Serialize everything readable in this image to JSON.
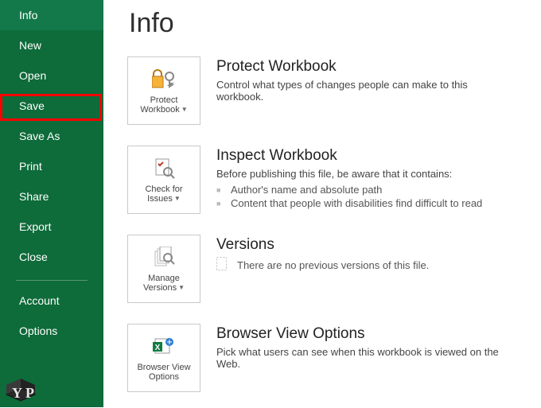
{
  "sidebar": {
    "items": [
      {
        "label": "Info",
        "active": true
      },
      {
        "label": "New"
      },
      {
        "label": "Open"
      },
      {
        "label": "Save",
        "highlighted": true
      },
      {
        "label": "Save As"
      },
      {
        "label": "Print"
      },
      {
        "label": "Share"
      },
      {
        "label": "Export"
      },
      {
        "label": "Close"
      }
    ],
    "footer": [
      {
        "label": "Account"
      },
      {
        "label": "Options"
      }
    ]
  },
  "page": {
    "title": "Info"
  },
  "protect": {
    "tile_line1": "Protect",
    "tile_line2": "Workbook",
    "title": "Protect Workbook",
    "desc": "Control what types of changes people can make to this workbook."
  },
  "inspect": {
    "tile_line1": "Check for",
    "tile_line2": "Issues",
    "title": "Inspect Workbook",
    "desc": "Before publishing this file, be aware that it contains:",
    "bullets": [
      "Author's name and absolute path",
      "Content that people with disabilities find difficult to read"
    ]
  },
  "versions": {
    "tile_line1": "Manage",
    "tile_line2": "Versions",
    "title": "Versions",
    "text": "There are no previous versions of this file."
  },
  "browser": {
    "tile_line1": "Browser View",
    "tile_line2": "Options",
    "title": "Browser View Options",
    "desc": "Pick what users can see when this workbook is viewed on the Web."
  }
}
